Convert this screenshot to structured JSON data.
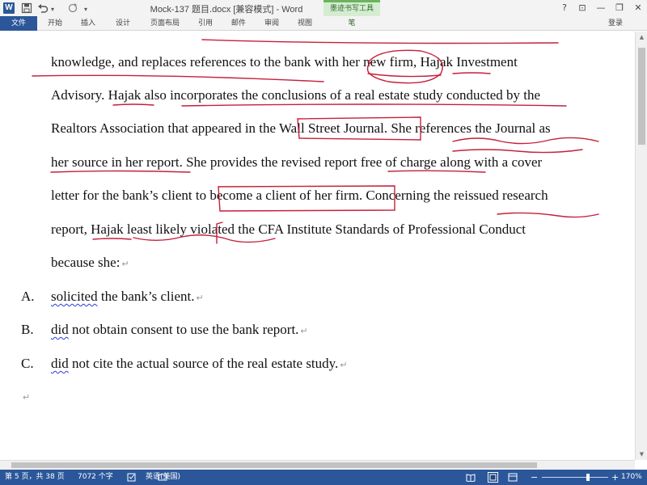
{
  "window": {
    "title": "Mock-137 题目.docx [兼容模式] - Word",
    "app_icon": "W",
    "controls": {
      "help": "?",
      "ribbon_display": "⊡",
      "minimize": "—",
      "restore": "❐",
      "close": "✕"
    }
  },
  "quick_access": {
    "save": "save-icon",
    "undo": "undo-icon",
    "redo": "redo-icon",
    "dropdown": "▾"
  },
  "ribbon": {
    "file_tab": "文件",
    "tabs": [
      "开始",
      "插入",
      "设计",
      "页面布局",
      "引用",
      "邮件",
      "审阅",
      "视图"
    ],
    "context_group_title": "墨迹书写工具",
    "context_tab": "笔",
    "sign_in": "登录"
  },
  "document": {
    "lines": [
      "knowledge, and replaces references to the bank with her new firm, Hajak Investment",
      "Advisory. Hajak also incorporates the conclusions of a real estate study conducted by the",
      "Realtors Association that appeared in the Wall Street Journal. She references the Journal as",
      "her source in her report. She provides the revised report free of charge along with a cover",
      "letter for the bank’s client to become a client of her firm. Concerning the reissued research",
      "report, Hajak least likely violated the CFA Institute Standards of Professional Conduct"
    ],
    "last_line": "because she:",
    "options": [
      {
        "letter": "A.",
        "word": "solicited",
        "rest": " the bank’s client."
      },
      {
        "letter": "B.",
        "word": "did",
        "rest": " not obtain consent to use the bank report."
      },
      {
        "letter": "C.",
        "word": "did",
        "rest": " not cite the actual source of the real estate study."
      }
    ],
    "paragraph_mark": "↵",
    "ink_color": "#c4203c"
  },
  "status": {
    "page": "第 5 页，共 38 页",
    "words": "7072 个字",
    "language": "英语(美国)",
    "zoom_level": "170%",
    "zoom_minus": "−",
    "zoom_plus": "+",
    "zoom_slider_fraction": 0.7
  }
}
